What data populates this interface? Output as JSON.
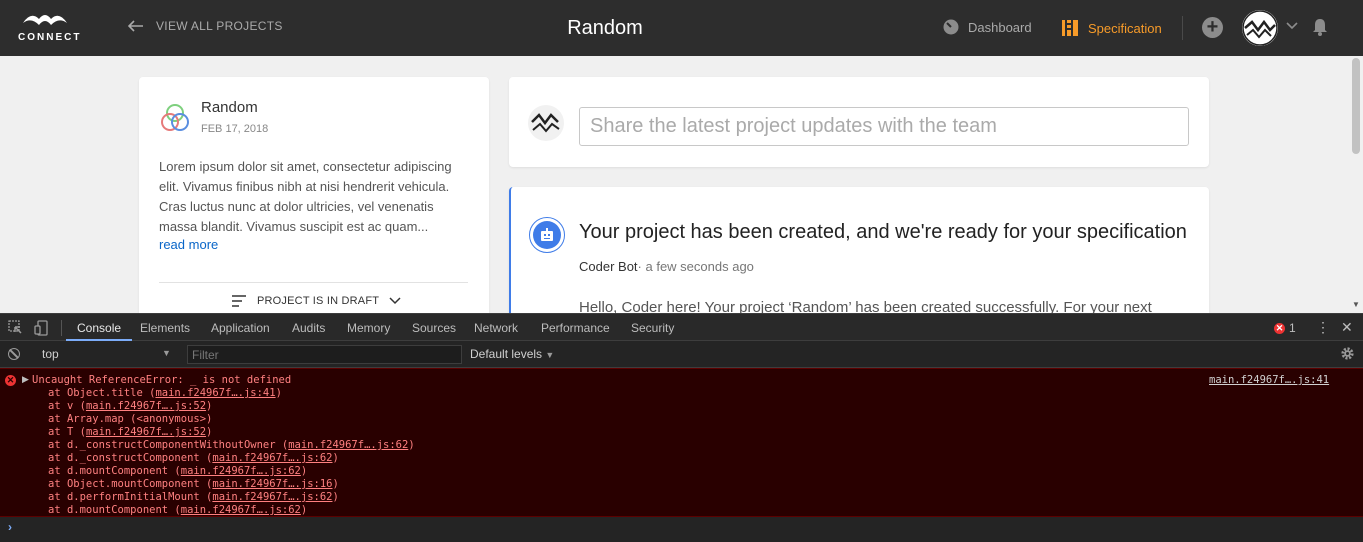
{
  "nav": {
    "logo_text": "CONNECT",
    "back_label": "VIEW ALL PROJECTS",
    "title": "Random",
    "dashboard_label": "Dashboard",
    "specification_label": "Specification",
    "add_label": "+",
    "accent_color": "#f79b29"
  },
  "project": {
    "name": "Random",
    "date": "FEB 17, 2018",
    "description": "Lorem ipsum dolor sit amet, consectetur adipiscing elit. Vivamus finibus nibh at nisi hendrerit vehicula. Cras luctus nunc at dolor ultricies, vel venenatis massa blandit. Vivamus suscipit est ac quam...",
    "read_more": "read more",
    "status": "PROJECT IS IN DRAFT"
  },
  "composer": {
    "placeholder": "Share the latest project updates with the team"
  },
  "post": {
    "title": "Your project has been created, and we're ready for your specification",
    "author": "Coder Bot",
    "time": "a few seconds ago",
    "body": "Hello, Coder here! Your project ‘Random’ has been created successfully. For your next",
    "accent_color": "#3f7ce8"
  },
  "devtools": {
    "tabs": [
      "Console",
      "Elements",
      "Application",
      "Audits",
      "Memory",
      "Sources",
      "Network",
      "Performance",
      "Security"
    ],
    "active_tab": "Console",
    "error_count": "1",
    "context": "top",
    "filter_placeholder": "Filter",
    "levels_label": "Default levels",
    "error": {
      "message": "Uncaught ReferenceError: _ is not defined",
      "source": "main.f24967f….js:41",
      "stack": [
        {
          "prefix": "at Object.title (",
          "link": "main.f24967f….js:41",
          "suffix": ")"
        },
        {
          "prefix": "at v (",
          "link": "main.f24967f….js:52",
          "suffix": ")"
        },
        {
          "prefix": "at Array.map (<anonymous>)",
          "link": "",
          "suffix": ""
        },
        {
          "prefix": "at T (",
          "link": "main.f24967f….js:52",
          "suffix": ")"
        },
        {
          "prefix": "at d._constructComponentWithoutOwner (",
          "link": "main.f24967f….js:62",
          "suffix": ")"
        },
        {
          "prefix": "at d._constructComponent (",
          "link": "main.f24967f….js:62",
          "suffix": ")"
        },
        {
          "prefix": "at d.mountComponent (",
          "link": "main.f24967f….js:62",
          "suffix": ")"
        },
        {
          "prefix": "at Object.mountComponent (",
          "link": "main.f24967f….js:16",
          "suffix": ")"
        },
        {
          "prefix": "at d.performInitialMount (",
          "link": "main.f24967f….js:62",
          "suffix": ")"
        },
        {
          "prefix": "at d.mountComponent (",
          "link": "main.f24967f….js:62",
          "suffix": ")"
        }
      ]
    }
  }
}
